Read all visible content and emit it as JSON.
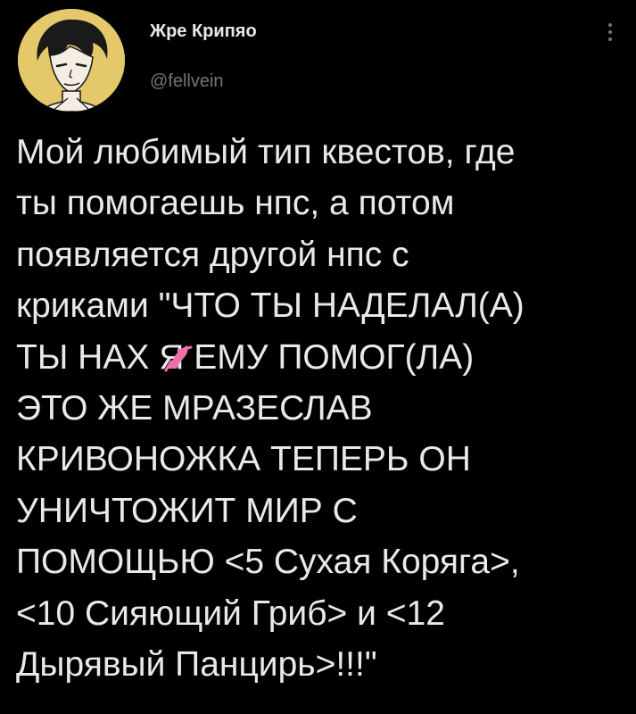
{
  "author": {
    "display_name": "Жре Крипяо",
    "handle": "@fellvein",
    "avatar_icon": "avatar-illustration"
  },
  "menu": {
    "icon": "more-vertical-icon"
  },
  "tweet": {
    "lines": [
      "Мой любимый тип квестов, где",
      "ты помогаешь нпс, а потом",
      "появляется другой нпс с",
      "криками \"ЧТО ТЫ НАДЕЛАЛ(А)",
      "ТЫ НАХ  Я ЕМУ ПОМОГ(ЛА)",
      "ЭТО ЖЕ МРАЗЕСЛАВ",
      "КРИВОНОЖКА ТЕПЕРЬ ОН",
      "УНИЧТОЖИТ МИР С",
      "ПОМОЩЬЮ <5 Сухая Коряга>,",
      "<10 Сияющий Гриб> и <12",
      "Дырявый Панцирь>!!!\""
    ]
  },
  "colors": {
    "background": "#000000",
    "text_primary": "#e7e9ea",
    "text_secondary": "#71767b",
    "avatar_bg": "#e4c86a",
    "censor_pink": "#f06fa8"
  }
}
